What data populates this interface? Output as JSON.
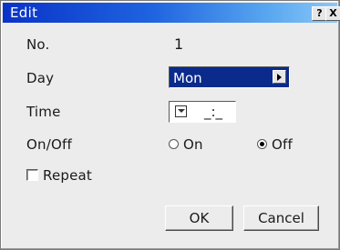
{
  "window": {
    "title": "Edit",
    "help_label": "?",
    "close_label": "X"
  },
  "fields": {
    "no_label": "No.",
    "no_value": "1",
    "day_label": "Day",
    "day_value": "Mon",
    "time_label": "Time",
    "time_value": "_:_",
    "onoff_label": "On/Off",
    "on_label": "On",
    "off_label": "Off",
    "onoff_selected": "Off",
    "repeat_label": "Repeat",
    "repeat_checked": false
  },
  "buttons": {
    "ok_label": "OK",
    "cancel_label": "Cancel"
  },
  "colors": {
    "title_gradient_start": "#0a33c8",
    "title_gradient_end": "#8cc8f8",
    "select_bg": "#0a2a8c",
    "dialog_bg": "#ececec"
  }
}
